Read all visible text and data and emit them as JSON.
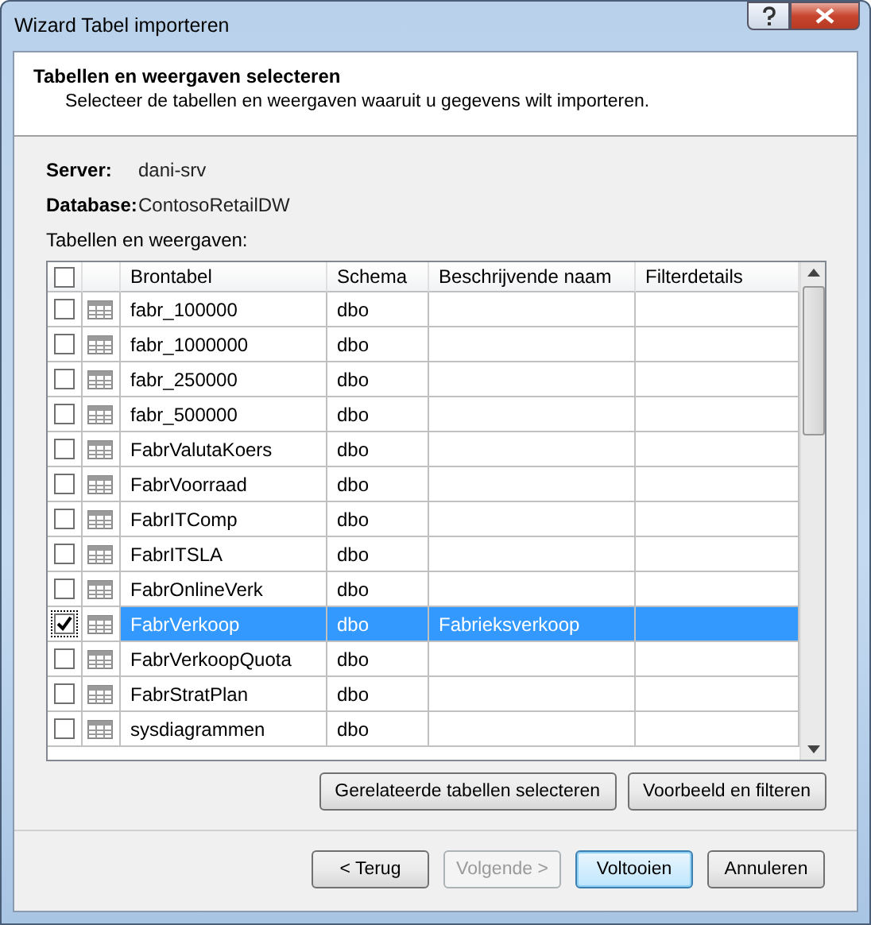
{
  "window": {
    "title": "Wizard Tabel importeren"
  },
  "header": {
    "title": "Tabellen en weergaven selecteren",
    "subtitle": "Selecteer de tabellen en weergaven waaruit u gegevens wilt importeren."
  },
  "info": [
    {
      "label": "Server:",
      "value": "dani-srv"
    },
    {
      "label": "Database:",
      "value": "ContosoRetailDW"
    }
  ],
  "table_label": "Tabellen en weergaven:",
  "table": {
    "select_all_checked": false,
    "columns": [
      "Brontabel",
      "Schema",
      "Beschrijvende naam",
      "Filterdetails"
    ],
    "rows": [
      {
        "checked": false,
        "selected": false,
        "name": "fabr_100000",
        "schema": "dbo",
        "friendly_name": ""
      },
      {
        "checked": false,
        "selected": false,
        "name": "fabr_1000000",
        "schema": "dbo",
        "friendly_name": ""
      },
      {
        "checked": false,
        "selected": false,
        "name": "fabr_250000",
        "schema": "dbo",
        "friendly_name": ""
      },
      {
        "checked": false,
        "selected": false,
        "name": "fabr_500000",
        "schema": "dbo",
        "friendly_name": ""
      },
      {
        "checked": false,
        "selected": false,
        "name": "FabrValutaKoers",
        "schema": "dbo",
        "friendly_name": ""
      },
      {
        "checked": false,
        "selected": false,
        "name": "FabrVoorraad",
        "schema": "dbo",
        "friendly_name": ""
      },
      {
        "checked": false,
        "selected": false,
        "name": "FabrITComp",
        "schema": "dbo",
        "friendly_name": ""
      },
      {
        "checked": false,
        "selected": false,
        "name": "FabrITSLA",
        "schema": "dbo",
        "friendly_name": ""
      },
      {
        "checked": false,
        "selected": false,
        "name": "FabrOnlineVerk",
        "schema": "dbo",
        "friendly_name": ""
      },
      {
        "checked": true,
        "selected": true,
        "name": "FabrVerkoop",
        "schema": "dbo",
        "friendly_name": "Fabrieksverkoop"
      },
      {
        "checked": false,
        "selected": false,
        "name": "FabrVerkoopQuota",
        "schema": "dbo",
        "friendly_name": ""
      },
      {
        "checked": false,
        "selected": false,
        "name": "FabrStratPlan",
        "schema": "dbo",
        "friendly_name": ""
      },
      {
        "checked": false,
        "selected": false,
        "name": "sysdiagrammen",
        "schema": "dbo",
        "friendly_name": ""
      }
    ]
  },
  "table_buttons": [
    {
      "label": "Gerelateerde tabellen selecteren",
      "disabled": false
    },
    {
      "label": "Voorbeeld en filteren",
      "disabled": false
    }
  ],
  "nav_buttons": [
    {
      "label": "< Terug",
      "disabled": false,
      "default": false
    },
    {
      "label": "Volgende >",
      "disabled": true,
      "default": false
    },
    {
      "label": "Voltooien",
      "disabled": false,
      "default": true
    },
    {
      "label": "Annuleren",
      "disabled": false,
      "default": false
    }
  ]
}
